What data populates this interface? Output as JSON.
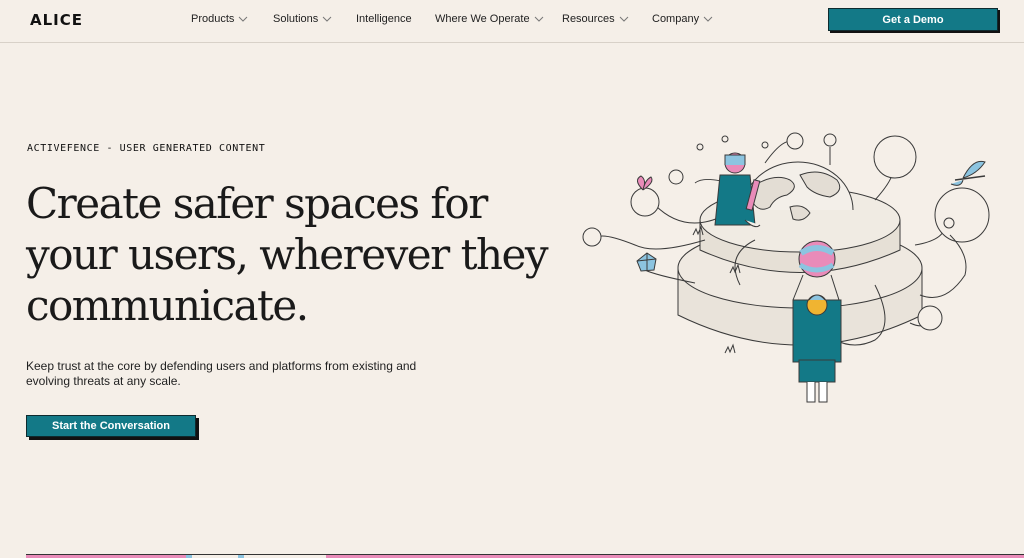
{
  "header": {
    "logo": "ALICE",
    "nav": [
      {
        "label": "Products",
        "dropdown": true
      },
      {
        "label": "Solutions",
        "dropdown": true
      },
      {
        "label": "Intelligence",
        "dropdown": false
      },
      {
        "label": "Where We Operate",
        "dropdown": true
      },
      {
        "label": "Resources",
        "dropdown": true
      },
      {
        "label": "Company",
        "dropdown": true
      }
    ],
    "demo_button": "Get a Demo"
  },
  "hero": {
    "eyebrow": "ACTIVEFENCE - USER GENERATED CONTENT",
    "headline": "Create safer spaces for your users, wherever they communicate.",
    "subtext": "Keep trust at the core by defending users and platforms from existing and evolving threats at any scale.",
    "cta": "Start the Conversation"
  },
  "colors": {
    "background": "#f5efe8",
    "accent": "#137987",
    "pink": "#e98bb9",
    "blue": "#8cc4e0"
  },
  "icons": [
    "chevron-down-icon",
    "globe-illustration",
    "butterfly-icon",
    "dragonfly-icon",
    "gem-icon"
  ]
}
